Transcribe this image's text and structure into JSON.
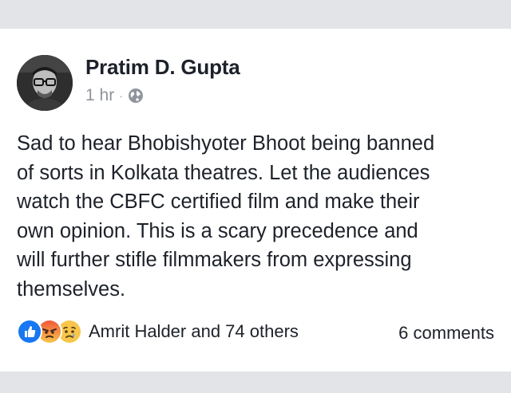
{
  "post": {
    "author": "Pratim D. Gupta",
    "time": "1 hr",
    "separator": "·",
    "privacy_icon": "globe-icon",
    "text": "Sad to hear Bhobishyoter Bhoot being banned\nof sorts in Kolkata theatres. Let the audiences\nwatch the CBFC certified film and make their\nown opinion. This is a scary precedence and\nwill further stifle filmmakers from expressing\nthemselves."
  },
  "engagement": {
    "reactions": [
      "like-reaction-icon",
      "angry-reaction-icon",
      "sad-reaction-icon"
    ],
    "reactors": "Amrit Halder and 74 others",
    "comments": "6 comments"
  },
  "colors": {
    "like": "#1877f2",
    "angry": "#f0573b",
    "sad": "#f7c64b",
    "text": "#1d2129",
    "meta": "#90949c",
    "band": "#e3e4e8"
  }
}
